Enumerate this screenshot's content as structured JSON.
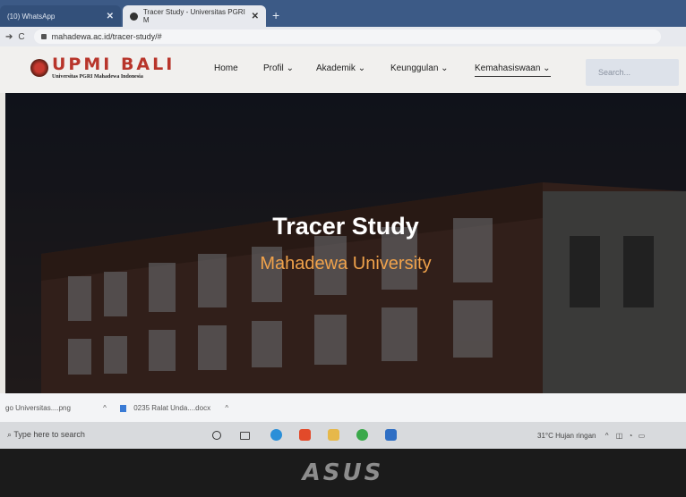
{
  "browser": {
    "tabs": [
      {
        "label": "(10) WhatsApp"
      },
      {
        "label": "Tracer Study - Universitas PGRI M"
      }
    ],
    "url": "mahadewa.ac.id/tracer-study/#"
  },
  "site": {
    "logo": {
      "name": "UPMI BALI",
      "subtitle": "Universitas PGRI Mahadewa Indonesia"
    },
    "menu": [
      "Home",
      "Profil",
      "Akademik",
      "Keunggulan",
      "Kemahasiswaan"
    ],
    "search_placeholder": "Search..."
  },
  "hero": {
    "title": "Tracer Study",
    "subtitle": "Mahadewa University"
  },
  "downloads": [
    {
      "label": "go Universitas....png"
    },
    {
      "label": "0235 Ralat Unda....docx"
    }
  ],
  "taskbar": {
    "search_placeholder": "Type here to search",
    "weather": "31°C  Hujan ringan"
  },
  "laptop": {
    "brand": "ASUS"
  },
  "colors": {
    "accent": "#f0a24b",
    "logo": "#b8352b"
  }
}
